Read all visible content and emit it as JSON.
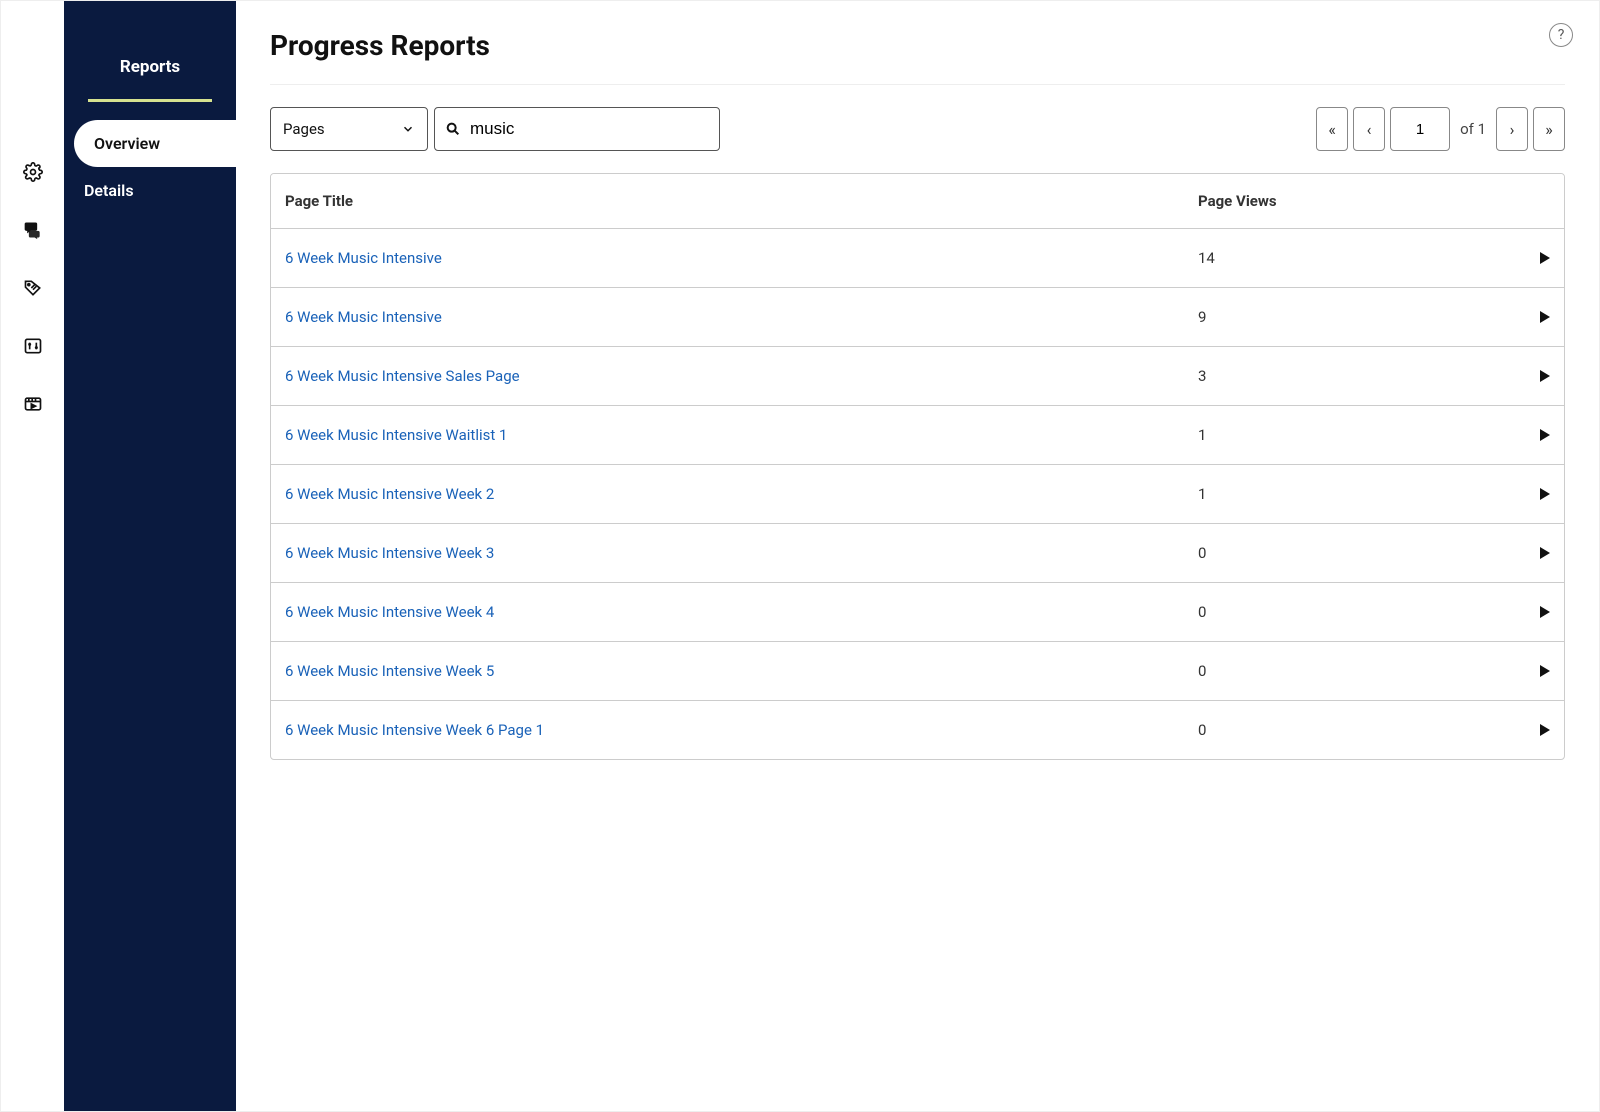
{
  "sidebar": {
    "title": "Reports",
    "items": [
      {
        "label": "Overview",
        "active": true
      },
      {
        "label": "Details",
        "active": false
      }
    ]
  },
  "help": {
    "label": "?"
  },
  "page": {
    "title": "Progress Reports"
  },
  "filter": {
    "selected": "Pages"
  },
  "search": {
    "value": "music"
  },
  "pagination": {
    "current": "1",
    "total_label": "of 1"
  },
  "table": {
    "headers": {
      "title": "Page Title",
      "views": "Page Views"
    },
    "rows": [
      {
        "title": "6 Week Music Intensive",
        "views": "14"
      },
      {
        "title": "6 Week Music Intensive",
        "views": "9"
      },
      {
        "title": "6 Week Music Intensive Sales Page",
        "views": "3"
      },
      {
        "title": "6 Week Music Intensive Waitlist 1",
        "views": "1"
      },
      {
        "title": "6 Week Music Intensive Week 2",
        "views": "1"
      },
      {
        "title": "6 Week Music Intensive Week 3",
        "views": "0"
      },
      {
        "title": "6 Week Music Intensive Week 4",
        "views": "0"
      },
      {
        "title": "6 Week Music Intensive Week 5",
        "views": "0"
      },
      {
        "title": "6 Week Music Intensive Week 6 Page 1",
        "views": "0"
      }
    ]
  }
}
